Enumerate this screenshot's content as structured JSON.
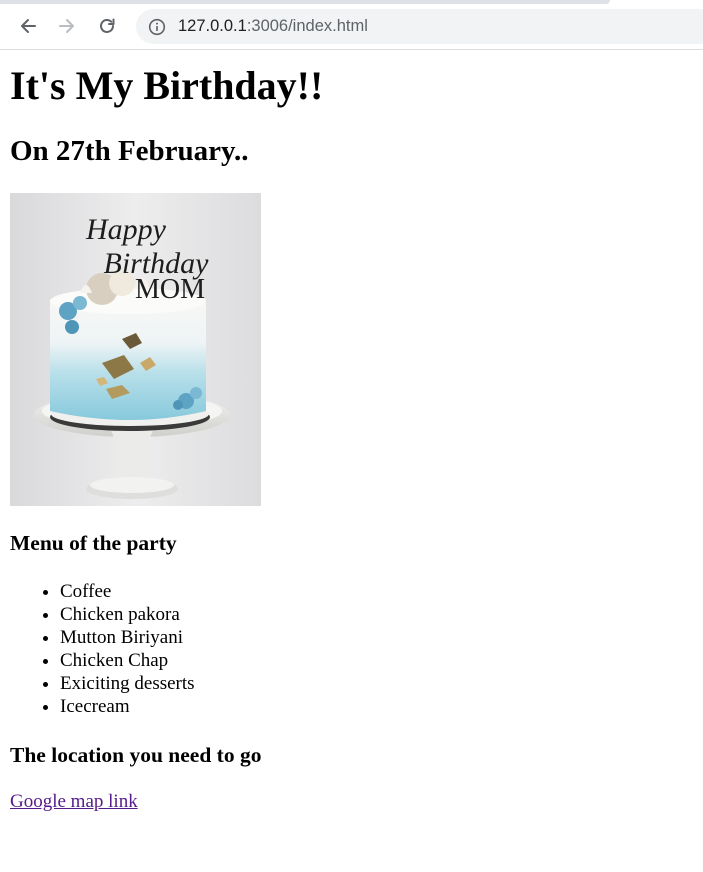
{
  "browser": {
    "url_host": "127.0.0.1",
    "url_rest": ":3006/index.html",
    "icons": [
      "back-arrow-icon",
      "forward-arrow-icon",
      "reload-icon",
      "info-icon"
    ]
  },
  "page": {
    "title": "It's My Birthday!!",
    "date": "On 27th February..",
    "cake_image": {
      "topper_line1": "Happy",
      "topper_line2": "Birthday",
      "topper_line3": "MOM"
    },
    "menu_heading": "Menu of the party",
    "menu_items": [
      "Coffee",
      "Chicken pakora",
      "Mutton Biriyani",
      "Chicken Chap",
      "Exiciting desserts",
      "Icecream"
    ],
    "location_heading": "The location you need to go",
    "map_link": "Google map link",
    "colors": {
      "link_visited": "#551a8b",
      "text": "#000000"
    }
  }
}
